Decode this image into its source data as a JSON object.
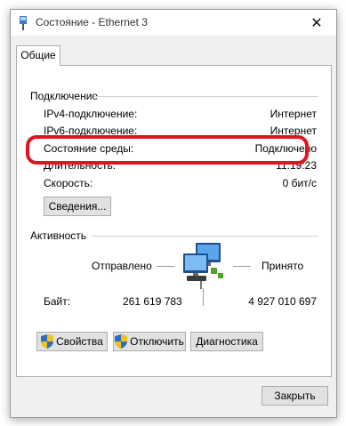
{
  "window": {
    "title": "Состояние - Ethernet 3",
    "close_glyph": "✕"
  },
  "tabs": [
    {
      "label": "Общие"
    }
  ],
  "connection": {
    "title": "Подключение",
    "rows": [
      {
        "label": "IPv4-подключение:",
        "value": "Интернет"
      },
      {
        "label": "IPv6-подключение:",
        "value": "Интернет"
      },
      {
        "label": "Состояние среды:",
        "value": "Подключено"
      },
      {
        "label": "Длительность:",
        "value": "11:19:23"
      },
      {
        "label": "Скорость:",
        "value": "0 бит/с"
      }
    ],
    "details_button": "Сведения..."
  },
  "activity": {
    "title": "Активность",
    "sent_label": "Отправлено",
    "received_label": "Принято",
    "bytes_label": "Байт:",
    "bytes_sent": "261 619 783",
    "bytes_received": "4 927 010 697"
  },
  "buttons": {
    "properties": "Свойства",
    "disable": "Отключить",
    "diagnose": "Диагностика",
    "close": "Закрыть"
  },
  "colors": {
    "highlight": "#e0141e",
    "window_bg": "#f0f0f0"
  },
  "icons": {
    "title": "network-adapter-icon",
    "shield": "uac-shield-icon",
    "activity": "network-computers-icon"
  }
}
